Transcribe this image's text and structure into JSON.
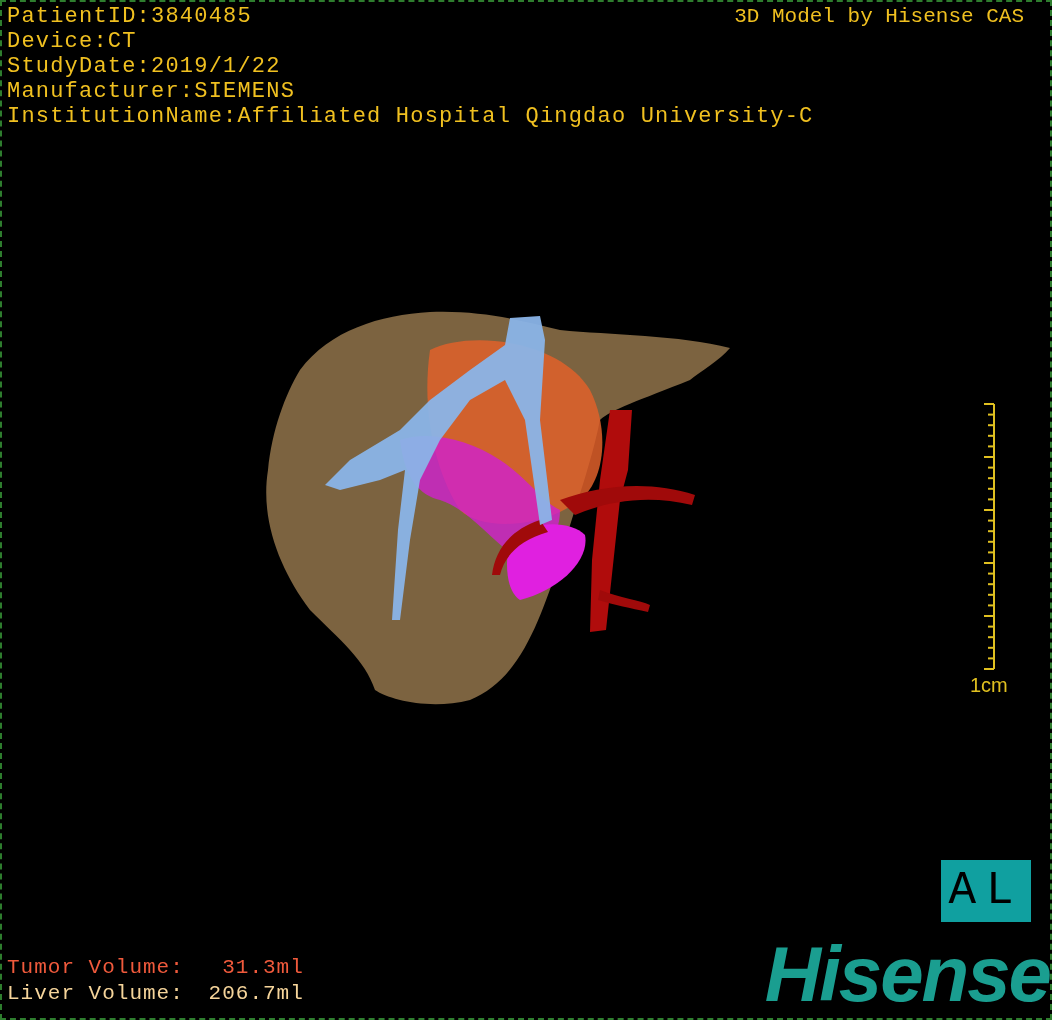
{
  "header": {
    "info": [
      "PatientID:3840485",
      "Device:CT",
      "StudyDate:2019/1/22",
      "Manufacturer:SIEMENS",
      "InstitutionName:Affiliated Hospital Qingdao University-C"
    ],
    "credit": "3D Model by Hisense CAS"
  },
  "scale_bar": {
    "label": "1cm"
  },
  "orientation_badge": "AL",
  "volumes": [
    {
      "label": "Tumor Volume:",
      "value": "31.3ml",
      "color": "#f05a3c"
    },
    {
      "label": "Liver Volume:",
      "value": "206.7ml",
      "color": "#f5d49a"
    }
  ],
  "logo": "Hisense"
}
